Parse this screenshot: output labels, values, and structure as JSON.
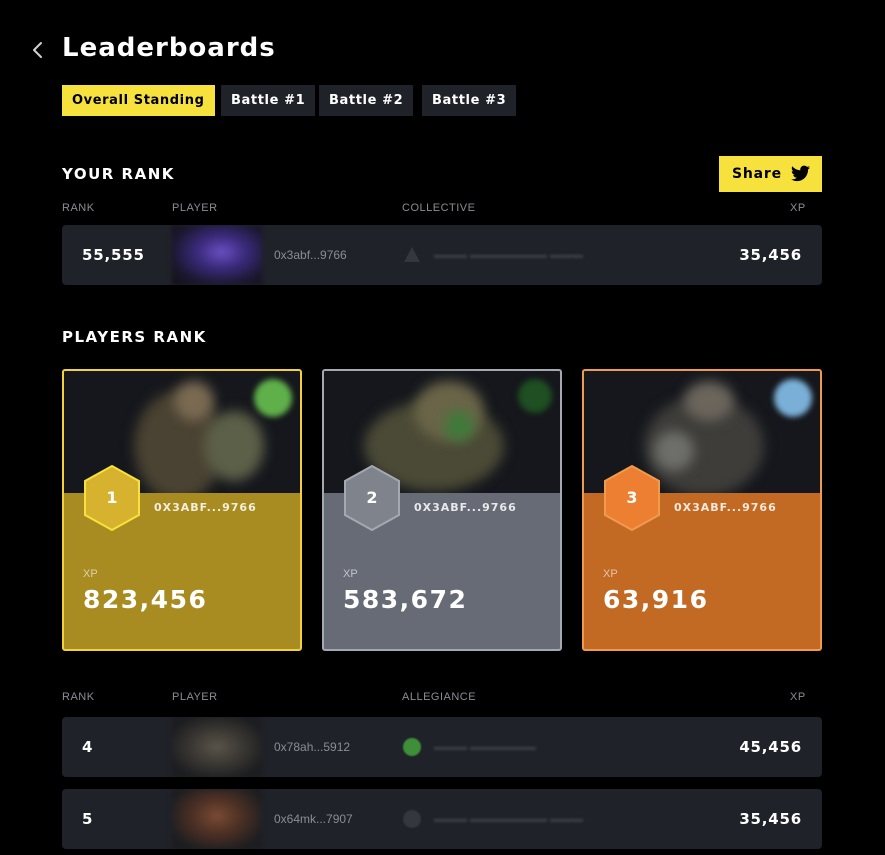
{
  "page": {
    "title": "Leaderboards",
    "back_icon": "chevron-left-icon"
  },
  "tabs": [
    {
      "label": "Overall Standing",
      "active": true
    },
    {
      "label": "Battle #1",
      "active": false
    },
    {
      "label": "Battle #2",
      "active": false
    },
    {
      "label": "Battle #3",
      "active": false
    }
  ],
  "your_rank": {
    "title": "YOUR RANK",
    "share_label": "Share",
    "share_icon": "twitter-icon",
    "columns": {
      "rank": "RANK",
      "player": "PLAYER",
      "collective": "COLLECTIVE",
      "xp": "XP"
    },
    "row": {
      "rank": "55,555",
      "address": "0x3abf...9766",
      "xp": "35,456"
    }
  },
  "players_rank": {
    "title": "PLAYERS RANK",
    "cards": [
      {
        "rank": "1",
        "address": "0X3ABF...9766",
        "xp_label": "XP",
        "xp": "823,456",
        "color": "#a88c22",
        "border": "#f2d13a",
        "hex": "#d6b22e"
      },
      {
        "rank": "2",
        "address": "0X3ABF...9766",
        "xp_label": "XP",
        "xp": "583,672",
        "color": "#676b75",
        "border": "#a4a8b0",
        "hex": "#7f838c"
      },
      {
        "rank": "3",
        "address": "0X3ABF...9766",
        "xp_label": "XP",
        "xp": "63,916",
        "color": "#c26a24",
        "border": "#f19a4d",
        "hex": "#ec7f31"
      }
    ],
    "columns": {
      "rank": "RANK",
      "player": "PLAYER",
      "allegiance": "ALLEGIANCE",
      "xp": "XP"
    },
    "rows": [
      {
        "rank": "4",
        "address": "0x78ah...5912",
        "xp": "45,456"
      },
      {
        "rank": "5",
        "address": "0x64mk...7907",
        "xp": "35,456"
      }
    ]
  },
  "colors": {
    "accent": "#f7e13c",
    "panel": "#1f2229",
    "background": "#000000"
  }
}
